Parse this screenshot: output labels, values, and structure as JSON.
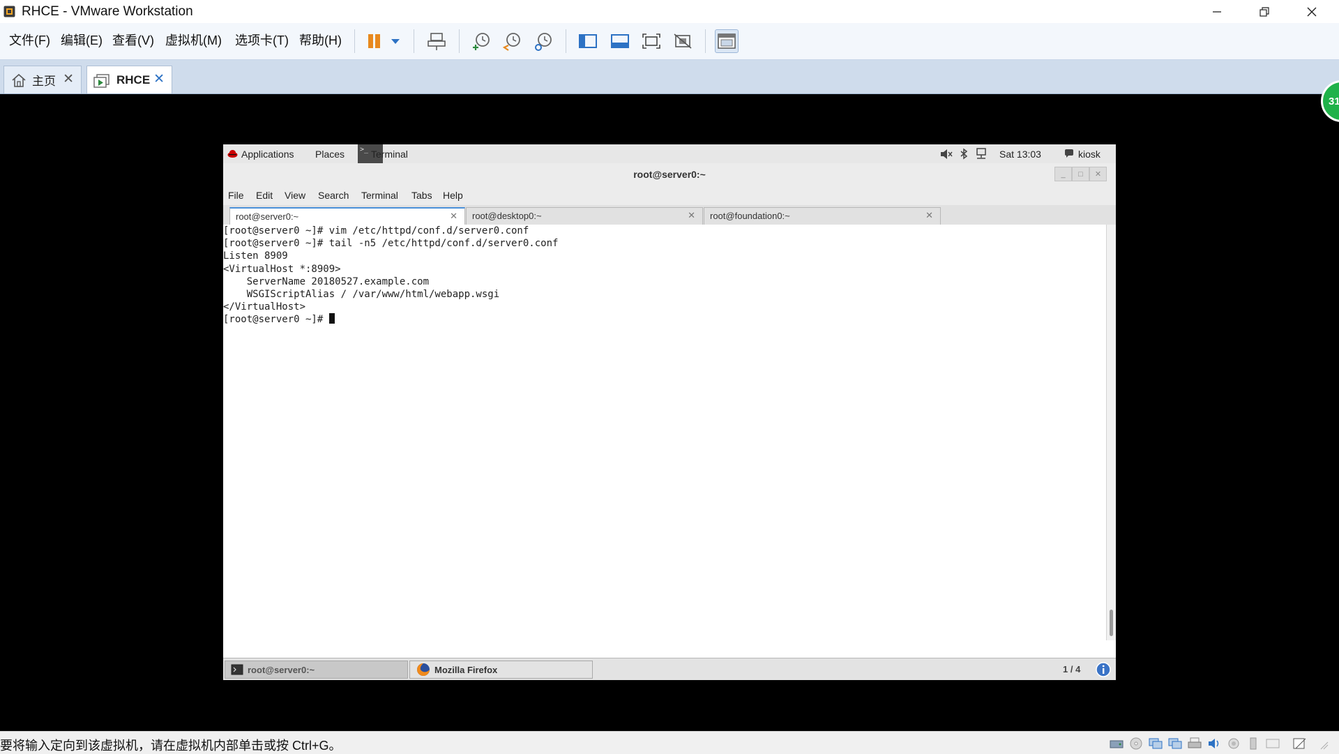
{
  "window": {
    "title": "RHCE - VMware Workstation"
  },
  "menubar": {
    "items": [
      "文件(F)",
      "编辑(E)",
      "查看(V)",
      "虚拟机(M)",
      "选项卡(T)",
      "帮助(H)"
    ]
  },
  "vm_tabs": [
    {
      "label": "主页",
      "active": false
    },
    {
      "label": "RHCE",
      "active": true
    }
  ],
  "badge": {
    "text": "31"
  },
  "gnome_topbar": {
    "applications": "Applications",
    "places": "Places",
    "terminal": "Terminal",
    "clock": "Sat 13:03",
    "user": "kiosk"
  },
  "terminal": {
    "title": "root@server0:~",
    "menu": [
      "File",
      "Edit",
      "View",
      "Search",
      "Terminal",
      "Tabs",
      "Help"
    ],
    "tabs": [
      {
        "label": "root@server0:~",
        "active": true
      },
      {
        "label": "root@desktop0:~",
        "active": false
      },
      {
        "label": "root@foundation0:~",
        "active": false
      }
    ],
    "lines": [
      "[root@server0 ~]# vim /etc/httpd/conf.d/server0.conf",
      "[root@server0 ~]# tail -n5 /etc/httpd/conf.d/server0.conf",
      "Listen 8909",
      "<VirtualHost *:8909>",
      "    ServerName 20180527.example.com",
      "    WSGIScriptAlias / /var/www/html/webapp.wsgi",
      "</VirtualHost>"
    ],
    "prompt": "[root@server0 ~]# "
  },
  "gnome_bottombar": {
    "tasks": [
      {
        "label": "root@server0:~",
        "active": true
      },
      {
        "label": "Mozilla Firefox",
        "active": false
      }
    ],
    "workspace": "1 / 4"
  },
  "statusbar": {
    "text": "要将输入定向到该虚拟机，请在虚拟机内部单击或按 Ctrl+G。"
  },
  "colors": {
    "accent": "#4a90d9",
    "vm_orange": "#e8891e",
    "badge_green": "#1fb24a",
    "toolbar_blue": "#2d72c4"
  }
}
